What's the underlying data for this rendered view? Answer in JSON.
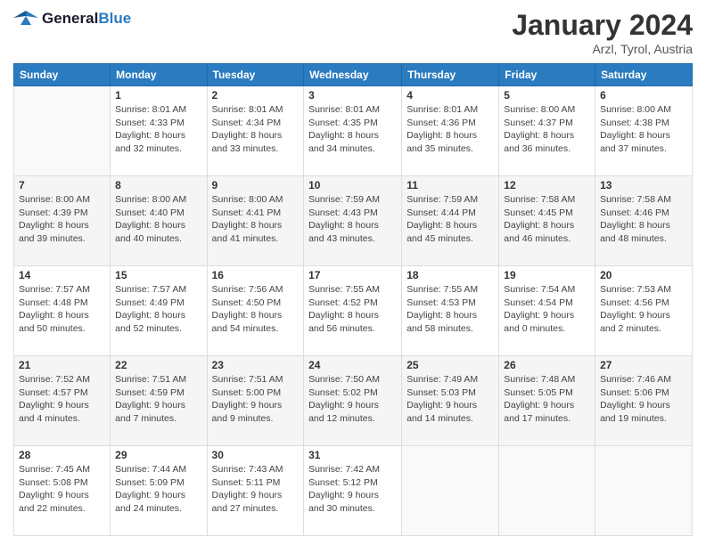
{
  "logo": {
    "text_general": "General",
    "text_blue": "Blue"
  },
  "header": {
    "month_year": "January 2024",
    "location": "Arzl, Tyrol, Austria"
  },
  "weekdays": [
    "Sunday",
    "Monday",
    "Tuesday",
    "Wednesday",
    "Thursday",
    "Friday",
    "Saturday"
  ],
  "weeks": [
    [
      {
        "day": "",
        "sunrise": "",
        "sunset": "",
        "daylight": ""
      },
      {
        "day": "1",
        "sunrise": "Sunrise: 8:01 AM",
        "sunset": "Sunset: 4:33 PM",
        "daylight": "Daylight: 8 hours and 32 minutes."
      },
      {
        "day": "2",
        "sunrise": "Sunrise: 8:01 AM",
        "sunset": "Sunset: 4:34 PM",
        "daylight": "Daylight: 8 hours and 33 minutes."
      },
      {
        "day": "3",
        "sunrise": "Sunrise: 8:01 AM",
        "sunset": "Sunset: 4:35 PM",
        "daylight": "Daylight: 8 hours and 34 minutes."
      },
      {
        "day": "4",
        "sunrise": "Sunrise: 8:01 AM",
        "sunset": "Sunset: 4:36 PM",
        "daylight": "Daylight: 8 hours and 35 minutes."
      },
      {
        "day": "5",
        "sunrise": "Sunrise: 8:00 AM",
        "sunset": "Sunset: 4:37 PM",
        "daylight": "Daylight: 8 hours and 36 minutes."
      },
      {
        "day": "6",
        "sunrise": "Sunrise: 8:00 AM",
        "sunset": "Sunset: 4:38 PM",
        "daylight": "Daylight: 8 hours and 37 minutes."
      }
    ],
    [
      {
        "day": "7",
        "sunrise": "Sunrise: 8:00 AM",
        "sunset": "Sunset: 4:39 PM",
        "daylight": "Daylight: 8 hours and 39 minutes."
      },
      {
        "day": "8",
        "sunrise": "Sunrise: 8:00 AM",
        "sunset": "Sunset: 4:40 PM",
        "daylight": "Daylight: 8 hours and 40 minutes."
      },
      {
        "day": "9",
        "sunrise": "Sunrise: 8:00 AM",
        "sunset": "Sunset: 4:41 PM",
        "daylight": "Daylight: 8 hours and 41 minutes."
      },
      {
        "day": "10",
        "sunrise": "Sunrise: 7:59 AM",
        "sunset": "Sunset: 4:43 PM",
        "daylight": "Daylight: 8 hours and 43 minutes."
      },
      {
        "day": "11",
        "sunrise": "Sunrise: 7:59 AM",
        "sunset": "Sunset: 4:44 PM",
        "daylight": "Daylight: 8 hours and 45 minutes."
      },
      {
        "day": "12",
        "sunrise": "Sunrise: 7:58 AM",
        "sunset": "Sunset: 4:45 PM",
        "daylight": "Daylight: 8 hours and 46 minutes."
      },
      {
        "day": "13",
        "sunrise": "Sunrise: 7:58 AM",
        "sunset": "Sunset: 4:46 PM",
        "daylight": "Daylight: 8 hours and 48 minutes."
      }
    ],
    [
      {
        "day": "14",
        "sunrise": "Sunrise: 7:57 AM",
        "sunset": "Sunset: 4:48 PM",
        "daylight": "Daylight: 8 hours and 50 minutes."
      },
      {
        "day": "15",
        "sunrise": "Sunrise: 7:57 AM",
        "sunset": "Sunset: 4:49 PM",
        "daylight": "Daylight: 8 hours and 52 minutes."
      },
      {
        "day": "16",
        "sunrise": "Sunrise: 7:56 AM",
        "sunset": "Sunset: 4:50 PM",
        "daylight": "Daylight: 8 hours and 54 minutes."
      },
      {
        "day": "17",
        "sunrise": "Sunrise: 7:55 AM",
        "sunset": "Sunset: 4:52 PM",
        "daylight": "Daylight: 8 hours and 56 minutes."
      },
      {
        "day": "18",
        "sunrise": "Sunrise: 7:55 AM",
        "sunset": "Sunset: 4:53 PM",
        "daylight": "Daylight: 8 hours and 58 minutes."
      },
      {
        "day": "19",
        "sunrise": "Sunrise: 7:54 AM",
        "sunset": "Sunset: 4:54 PM",
        "daylight": "Daylight: 9 hours and 0 minutes."
      },
      {
        "day": "20",
        "sunrise": "Sunrise: 7:53 AM",
        "sunset": "Sunset: 4:56 PM",
        "daylight": "Daylight: 9 hours and 2 minutes."
      }
    ],
    [
      {
        "day": "21",
        "sunrise": "Sunrise: 7:52 AM",
        "sunset": "Sunset: 4:57 PM",
        "daylight": "Daylight: 9 hours and 4 minutes."
      },
      {
        "day": "22",
        "sunrise": "Sunrise: 7:51 AM",
        "sunset": "Sunset: 4:59 PM",
        "daylight": "Daylight: 9 hours and 7 minutes."
      },
      {
        "day": "23",
        "sunrise": "Sunrise: 7:51 AM",
        "sunset": "Sunset: 5:00 PM",
        "daylight": "Daylight: 9 hours and 9 minutes."
      },
      {
        "day": "24",
        "sunrise": "Sunrise: 7:50 AM",
        "sunset": "Sunset: 5:02 PM",
        "daylight": "Daylight: 9 hours and 12 minutes."
      },
      {
        "day": "25",
        "sunrise": "Sunrise: 7:49 AM",
        "sunset": "Sunset: 5:03 PM",
        "daylight": "Daylight: 9 hours and 14 minutes."
      },
      {
        "day": "26",
        "sunrise": "Sunrise: 7:48 AM",
        "sunset": "Sunset: 5:05 PM",
        "daylight": "Daylight: 9 hours and 17 minutes."
      },
      {
        "day": "27",
        "sunrise": "Sunrise: 7:46 AM",
        "sunset": "Sunset: 5:06 PM",
        "daylight": "Daylight: 9 hours and 19 minutes."
      }
    ],
    [
      {
        "day": "28",
        "sunrise": "Sunrise: 7:45 AM",
        "sunset": "Sunset: 5:08 PM",
        "daylight": "Daylight: 9 hours and 22 minutes."
      },
      {
        "day": "29",
        "sunrise": "Sunrise: 7:44 AM",
        "sunset": "Sunset: 5:09 PM",
        "daylight": "Daylight: 9 hours and 24 minutes."
      },
      {
        "day": "30",
        "sunrise": "Sunrise: 7:43 AM",
        "sunset": "Sunset: 5:11 PM",
        "daylight": "Daylight: 9 hours and 27 minutes."
      },
      {
        "day": "31",
        "sunrise": "Sunrise: 7:42 AM",
        "sunset": "Sunset: 5:12 PM",
        "daylight": "Daylight: 9 hours and 30 minutes."
      },
      {
        "day": "",
        "sunrise": "",
        "sunset": "",
        "daylight": ""
      },
      {
        "day": "",
        "sunrise": "",
        "sunset": "",
        "daylight": ""
      },
      {
        "day": "",
        "sunrise": "",
        "sunset": "",
        "daylight": ""
      }
    ]
  ]
}
